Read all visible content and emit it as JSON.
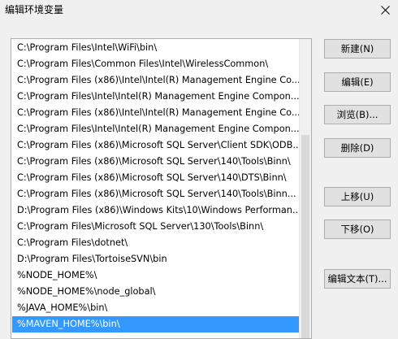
{
  "window": {
    "title": "编辑环境变量"
  },
  "list": {
    "items": [
      "C:\\Program Files\\Intel\\WiFi\\bin\\",
      "C:\\Program Files\\Common Files\\Intel\\WirelessCommon\\",
      "C:\\Program Files (x86)\\Intel\\Intel(R) Management Engine Co...",
      "C:\\Program Files\\Intel\\Intel(R) Management Engine Compon...",
      "C:\\Program Files (x86)\\Intel\\Intel(R) Management Engine Co...",
      "C:\\Program Files\\Intel\\Intel(R) Management Engine Compon...",
      "C:\\Program Files (x86)\\Microsoft SQL Server\\Client SDK\\ODB...",
      "C:\\Program Files (x86)\\Microsoft SQL Server\\140\\Tools\\Binn\\",
      "C:\\Program Files (x86)\\Microsoft SQL Server\\140\\DTS\\Binn\\",
      "C:\\Program Files (x86)\\Microsoft SQL Server\\140\\Tools\\Binn...",
      "D:\\Program Files (x86)\\Windows Kits\\10\\Windows Performan...",
      "C:\\Program Files\\Microsoft SQL Server\\130\\Tools\\Binn\\",
      "C:\\Program Files\\dotnet\\",
      "D:\\Program Files\\TortoiseSVN\\bin",
      "%NODE_HOME%\\",
      "%NODE_HOME%\\node_global\\",
      "%JAVA_HOME%\\bin\\",
      "%MAVEN_HOME%\\bin\\"
    ],
    "selected_index": 17
  },
  "buttons": {
    "new": "新建(N)",
    "edit": "编辑(E)",
    "browse": "浏览(B)...",
    "delete": "删除(D)",
    "move_up": "上移(U)",
    "move_down": "下移(O)",
    "edit_text": "编辑文本(T)..."
  },
  "colors": {
    "selection": "#3399ff",
    "window_bg": "#f0f0f0",
    "button_bg": "#e1e1e1"
  }
}
